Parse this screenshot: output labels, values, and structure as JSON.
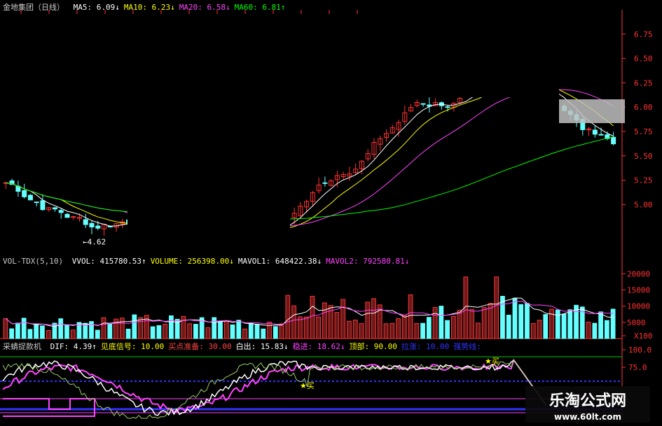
{
  "price_panel": {
    "title": "金地集团（日线）",
    "ma": [
      {
        "label": "MA5:",
        "value": "6.09",
        "arrow": "↓",
        "color": "#ffffff"
      },
      {
        "label": "MA10:",
        "value": "6.23",
        "arrow": "↓",
        "color": "#ffff00"
      },
      {
        "label": "MA20:",
        "value": "6.58",
        "arrow": "↓",
        "color": "#ff44ff"
      },
      {
        "label": "MA60:",
        "value": "6.81",
        "arrow": "↑",
        "color": "#00ff00"
      }
    ],
    "low_label": "←4.62"
  },
  "volume_panel": {
    "title": "VOL-TDX(5,10)",
    "items": [
      {
        "label": "VVOL:",
        "value": "415780.53",
        "arrow": "↑",
        "color": "#ffffff"
      },
      {
        "label": "VOLUME:",
        "value": "256398.00",
        "arrow": "↓",
        "color": "#ffff00"
      },
      {
        "label": "MAVOL1:",
        "value": "648422.38",
        "arrow": "↓",
        "color": "#ffffff"
      },
      {
        "label": "MAVOL2:",
        "value": "792580.81",
        "arrow": "↓",
        "color": "#ff44ff"
      }
    ]
  },
  "indicator_panel": {
    "title": "采蜻捉款机",
    "items": [
      {
        "label": "DIF:",
        "value": "4.39",
        "arrow": "↑",
        "color": "#ffffff"
      },
      {
        "label": "见底信号:",
        "value": "10.00",
        "arrow": "",
        "color": "#ffff00"
      },
      {
        "label": "买点准备:",
        "value": "30.00",
        "arrow": "",
        "color": "#ff4444"
      },
      {
        "label": "白出:",
        "value": "15.83",
        "arrow": "↓",
        "color": "#ffffff"
      },
      {
        "label": "稳进:",
        "value": "18.62",
        "arrow": "↓",
        "color": "#ff44ff"
      },
      {
        "label": "顶部:",
        "value": "90.00",
        "arrow": "",
        "color": "#ffff00"
      },
      {
        "label": "拉涨:",
        "value": "10.00",
        "arrow": "",
        "color": "#3333ff"
      },
      {
        "label": "强势线:",
        "value": "",
        "arrow": "",
        "color": "#3333ff"
      }
    ],
    "buy_label": "★买"
  },
  "watermark": {
    "line1": "乐淘公式网",
    "line2": "www.60lt.com"
  },
  "chart_data": [
    {
      "type": "candlestick",
      "ylim": [
        4.5,
        7.0
      ],
      "y_ticks": [
        "6.75",
        "6.50",
        "6.25",
        "6.00",
        "5.75",
        "5.50",
        "5.25",
        "5.00"
      ],
      "up_color": "#ff3333",
      "down_color": "#66ffff",
      "ma_colors": {
        "MA5": "#ffffff",
        "MA10": "#ffff00",
        "MA20": "#ff44ff",
        "MA60": "#00ff00"
      },
      "annotations": [
        {
          "text": "←4.62",
          "y": 4.62
        }
      ]
    },
    {
      "type": "bar",
      "y_ticks": [
        "20000",
        "15000",
        "10000",
        "5000",
        "X100"
      ],
      "ylim": [
        0,
        22000
      ]
    },
    {
      "type": "line",
      "y_ticks": [
        "100.0",
        "75.0"
      ],
      "ylim": [
        0,
        100
      ],
      "reference_lines": [
        90,
        30,
        10
      ]
    }
  ]
}
